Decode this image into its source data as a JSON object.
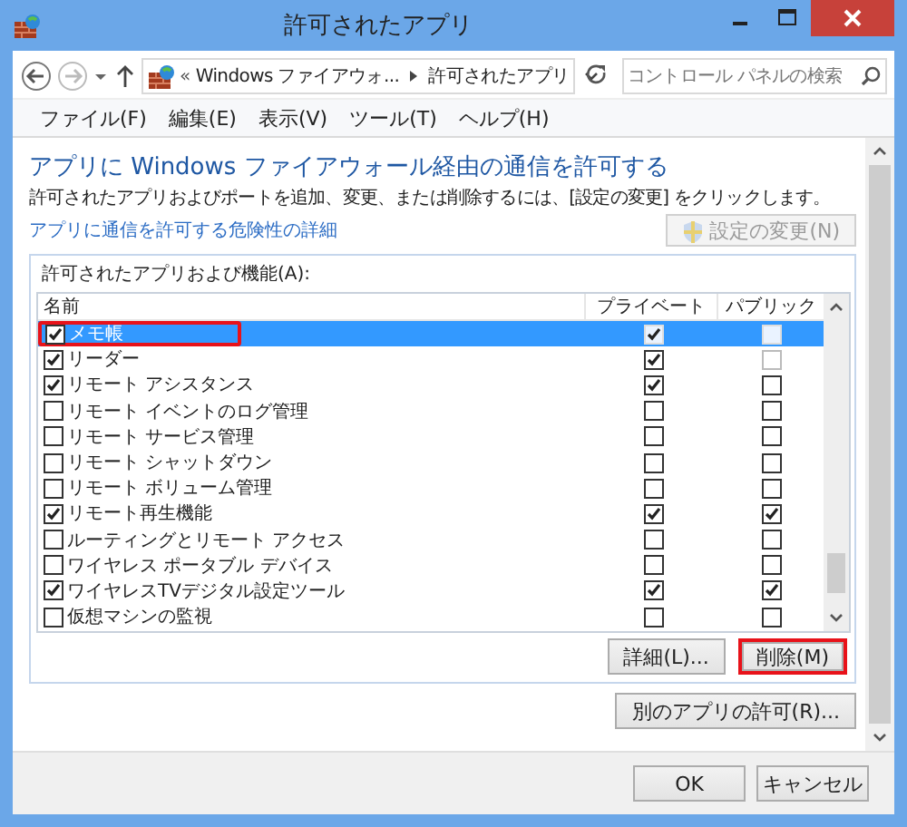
{
  "window": {
    "title": "許可されたアプリ"
  },
  "navigation": {
    "overflow": "«",
    "breadcrumbs": [
      "Windows ファイアウォ...",
      "許可されたアプリ"
    ],
    "search": {
      "placeholder": "コントロール パネルの検索"
    }
  },
  "menu": [
    "ファイル(F)",
    "編集(E)",
    "表示(V)",
    "ツール(T)",
    "ヘルプ(H)"
  ],
  "heading": "アプリに Windows ファイアウォール経由の通信を許可する",
  "description": "許可されたアプリおよびポートを追加、変更、または削除するには、[設定の変更] をクリックします。",
  "link": "アプリに通信を許可する危険性の詳細",
  "change_settings_button": {
    "label": "設定の変更(N)",
    "disabled": true
  },
  "group": {
    "label": "許可されたアプリおよび機能(A):",
    "columns": [
      "名前",
      "プライベート",
      "パブリック"
    ],
    "rows": [
      {
        "name": "メモ帳",
        "checked": true,
        "private": true,
        "public": false,
        "public_disabled": false,
        "selected": true,
        "highlighted": true
      },
      {
        "name": "リーダー",
        "checked": true,
        "private": true,
        "public": false,
        "public_disabled": true,
        "selected": false,
        "highlighted": false
      },
      {
        "name": "リモート アシスタンス",
        "checked": true,
        "private": true,
        "public": false,
        "public_disabled": false,
        "selected": false,
        "highlighted": false
      },
      {
        "name": "リモート イベントのログ管理",
        "checked": false,
        "private": false,
        "public": false,
        "public_disabled": false,
        "selected": false,
        "highlighted": false
      },
      {
        "name": "リモート サービス管理",
        "checked": false,
        "private": false,
        "public": false,
        "public_disabled": false,
        "selected": false,
        "highlighted": false
      },
      {
        "name": "リモート シャットダウン",
        "checked": false,
        "private": false,
        "public": false,
        "public_disabled": false,
        "selected": false,
        "highlighted": false
      },
      {
        "name": "リモート ボリューム管理",
        "checked": false,
        "private": false,
        "public": false,
        "public_disabled": false,
        "selected": false,
        "highlighted": false
      },
      {
        "name": "リモート再生機能",
        "checked": true,
        "private": true,
        "public": true,
        "public_disabled": false,
        "selected": false,
        "highlighted": false
      },
      {
        "name": "ルーティングとリモート アクセス",
        "checked": false,
        "private": false,
        "public": false,
        "public_disabled": false,
        "selected": false,
        "highlighted": false
      },
      {
        "name": "ワイヤレス ポータブル デバイス",
        "checked": false,
        "private": false,
        "public": false,
        "public_disabled": false,
        "selected": false,
        "highlighted": false
      },
      {
        "name": "ワイヤレスTVデジタル設定ツール",
        "checked": true,
        "private": true,
        "public": true,
        "public_disabled": false,
        "selected": false,
        "highlighted": false
      },
      {
        "name": "仮想マシンの監視",
        "checked": false,
        "private": false,
        "public": false,
        "public_disabled": false,
        "selected": false,
        "highlighted": false
      }
    ],
    "buttons": [
      {
        "label": "詳細(L)...",
        "highlighted": false
      },
      {
        "label": "削除(M)",
        "highlighted": true
      }
    ]
  },
  "allow_another_button": {
    "label": "別のアプリの許可(R)..."
  },
  "footer_buttons": [
    "OK",
    "キャンセル"
  ]
}
